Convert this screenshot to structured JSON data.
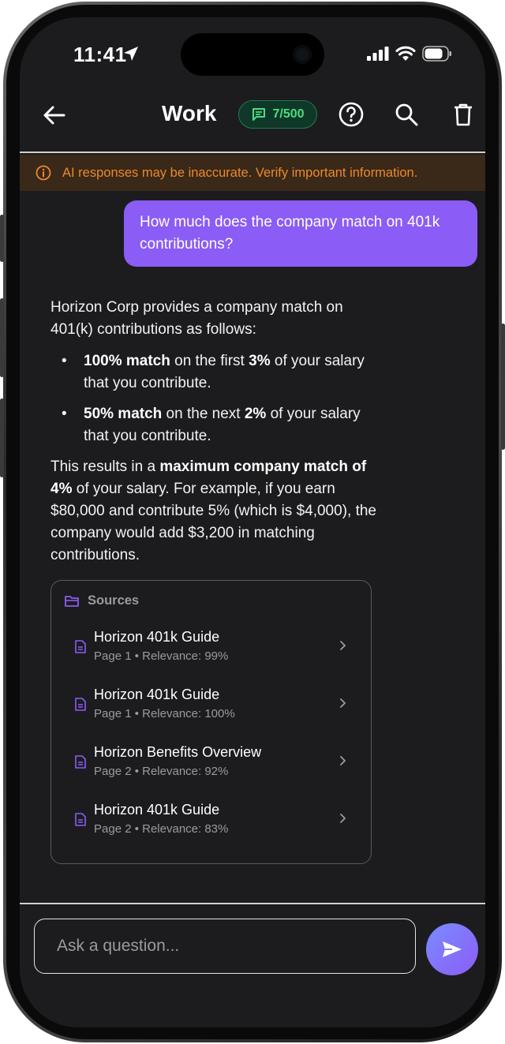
{
  "status_bar": {
    "time": "11:41"
  },
  "header": {
    "title": "Work",
    "message_count": "7/500",
    "back_icon": "arrow-left-icon",
    "help_icon": "help-circle-icon",
    "search_icon": "search-icon",
    "delete_icon": "trash-icon"
  },
  "warning": {
    "text": "AI responses may be inaccurate. Verify important information."
  },
  "user_message": {
    "text": "How much does the company match on 401k contributions?"
  },
  "answer": {
    "intro": "Horizon Corp provides a company match on 401(k) contributions as follows:",
    "bullets": [
      {
        "bold1": "100% match",
        "mid": " on the first ",
        "bold2": "3%",
        "tail": " of your salary that you contribute."
      },
      {
        "bold1": "50% match",
        "mid": " on the next ",
        "bold2": "2%",
        "tail": " of your salary that you contribute."
      }
    ],
    "summary_pre": "This results in a ",
    "summary_bold": "maximum company match of 4%",
    "summary_post": " of your salary. For example, if you earn $80,000 and contribute 5% (which is $4,000), the company would add $3,200 in matching contributions."
  },
  "sources": {
    "label": "Sources",
    "items": [
      {
        "title": "Horizon 401k Guide",
        "meta": "Page 1 • Relevance: 99%"
      },
      {
        "title": "Horizon 401k Guide",
        "meta": "Page 1 • Relevance: 100%"
      },
      {
        "title": "Horizon Benefits Overview",
        "meta": "Page 2 • Relevance: 92%"
      },
      {
        "title": "Horizon 401k Guide",
        "meta": "Page 2 • Relevance: 83%"
      }
    ]
  },
  "composer": {
    "placeholder": "Ask a question..."
  },
  "colors": {
    "accent": "#8b5cf6",
    "badge_green": "#4ade80",
    "warning_orange": "#ea8a2e",
    "background": "#1c1c1e"
  }
}
